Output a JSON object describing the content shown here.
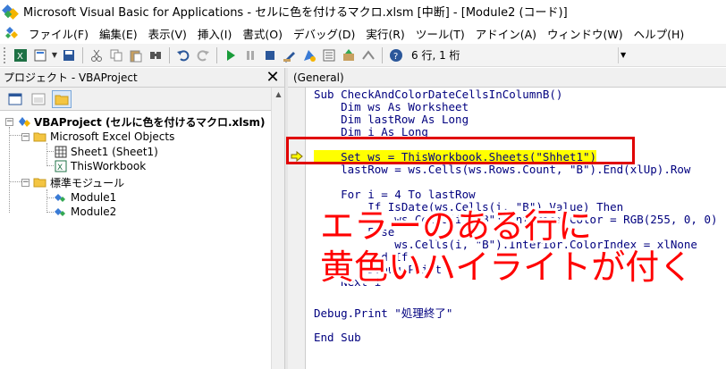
{
  "window": {
    "title": "Microsoft Visual Basic for Applications - セルに色を付けるマクロ.xlsm [中断] - [Module2 (コード)]"
  },
  "menu": {
    "items": [
      "ファイル(F)",
      "編集(E)",
      "表示(V)",
      "挿入(I)",
      "書式(O)",
      "デバッグ(D)",
      "実行(R)",
      "ツール(T)",
      "アドイン(A)",
      "ウィンドウ(W)",
      "ヘルプ(H)"
    ]
  },
  "toolbar": {
    "position": "6 行, 1 桁"
  },
  "project": {
    "header": "プロジェクト - VBAProject",
    "root": "VBAProject (セルに色を付けるマクロ.xlsm)",
    "excel_objects": "Microsoft Excel Objects",
    "sheet1": "Sheet1 (Sheet1)",
    "thisworkbook": "ThisWorkbook",
    "modules_folder": "標準モジュール",
    "module1": "Module1",
    "module2": "Module2"
  },
  "code": {
    "object_dropdown": "(General)",
    "lines": [
      "Sub CheckAndColorDateCellsInColumnB()",
      "    Dim ws As Worksheet",
      "    Dim lastRow As Long",
      "    Dim i As Long",
      "",
      "    Set ws = ThisWorkbook.Sheets(\"Shhet1\")",
      "    lastRow = ws.Cells(ws.Rows.Count, \"B\").End(xlUp).Row",
      "",
      "    For i = 4 To lastRow",
      "        If IsDate(ws.Cells(i, \"B\").Value) Then",
      "            ws.Cells(i, \"B\").Interior.Color = RGB(255, 0, 0)",
      "        Else",
      "            ws.Cells(i, \"B\").Interior.ColorIndex = xlNone",
      "        End If",
      "        Debug.Print i",
      "    Next i",
      "",
      "Debug.Print \"処理終了\"",
      "",
      "End Sub"
    ],
    "highlight_line": 5
  },
  "annotation": {
    "line1": "エラーのある行に",
    "line2": "黄色いハイライトが付く",
    "color": "#ff0000",
    "box_color": "#e00000"
  }
}
